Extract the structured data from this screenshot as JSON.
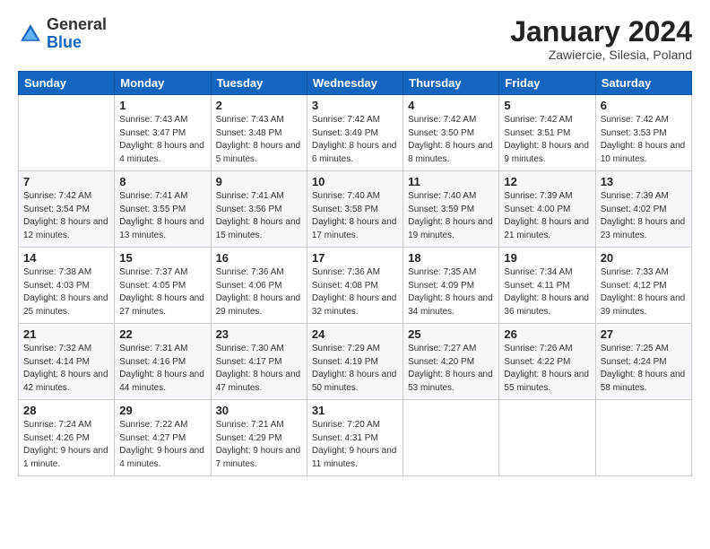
{
  "logo": {
    "general": "General",
    "blue": "Blue"
  },
  "title": "January 2024",
  "location": "Zawiercie, Silesia, Poland",
  "days_of_week": [
    "Sunday",
    "Monday",
    "Tuesday",
    "Wednesday",
    "Thursday",
    "Friday",
    "Saturday"
  ],
  "weeks": [
    [
      {
        "day": "",
        "sunrise": "",
        "sunset": "",
        "daylight": ""
      },
      {
        "day": "1",
        "sunrise": "Sunrise: 7:43 AM",
        "sunset": "Sunset: 3:47 PM",
        "daylight": "Daylight: 8 hours and 4 minutes."
      },
      {
        "day": "2",
        "sunrise": "Sunrise: 7:43 AM",
        "sunset": "Sunset: 3:48 PM",
        "daylight": "Daylight: 8 hours and 5 minutes."
      },
      {
        "day": "3",
        "sunrise": "Sunrise: 7:42 AM",
        "sunset": "Sunset: 3:49 PM",
        "daylight": "Daylight: 8 hours and 6 minutes."
      },
      {
        "day": "4",
        "sunrise": "Sunrise: 7:42 AM",
        "sunset": "Sunset: 3:50 PM",
        "daylight": "Daylight: 8 hours and 8 minutes."
      },
      {
        "day": "5",
        "sunrise": "Sunrise: 7:42 AM",
        "sunset": "Sunset: 3:51 PM",
        "daylight": "Daylight: 8 hours and 9 minutes."
      },
      {
        "day": "6",
        "sunrise": "Sunrise: 7:42 AM",
        "sunset": "Sunset: 3:53 PM",
        "daylight": "Daylight: 8 hours and 10 minutes."
      }
    ],
    [
      {
        "day": "7",
        "sunrise": "Sunrise: 7:42 AM",
        "sunset": "Sunset: 3:54 PM",
        "daylight": "Daylight: 8 hours and 12 minutes."
      },
      {
        "day": "8",
        "sunrise": "Sunrise: 7:41 AM",
        "sunset": "Sunset: 3:55 PM",
        "daylight": "Daylight: 8 hours and 13 minutes."
      },
      {
        "day": "9",
        "sunrise": "Sunrise: 7:41 AM",
        "sunset": "Sunset: 3:56 PM",
        "daylight": "Daylight: 8 hours and 15 minutes."
      },
      {
        "day": "10",
        "sunrise": "Sunrise: 7:40 AM",
        "sunset": "Sunset: 3:58 PM",
        "daylight": "Daylight: 8 hours and 17 minutes."
      },
      {
        "day": "11",
        "sunrise": "Sunrise: 7:40 AM",
        "sunset": "Sunset: 3:59 PM",
        "daylight": "Daylight: 8 hours and 19 minutes."
      },
      {
        "day": "12",
        "sunrise": "Sunrise: 7:39 AM",
        "sunset": "Sunset: 4:00 PM",
        "daylight": "Daylight: 8 hours and 21 minutes."
      },
      {
        "day": "13",
        "sunrise": "Sunrise: 7:39 AM",
        "sunset": "Sunset: 4:02 PM",
        "daylight": "Daylight: 8 hours and 23 minutes."
      }
    ],
    [
      {
        "day": "14",
        "sunrise": "Sunrise: 7:38 AM",
        "sunset": "Sunset: 4:03 PM",
        "daylight": "Daylight: 8 hours and 25 minutes."
      },
      {
        "day": "15",
        "sunrise": "Sunrise: 7:37 AM",
        "sunset": "Sunset: 4:05 PM",
        "daylight": "Daylight: 8 hours and 27 minutes."
      },
      {
        "day": "16",
        "sunrise": "Sunrise: 7:36 AM",
        "sunset": "Sunset: 4:06 PM",
        "daylight": "Daylight: 8 hours and 29 minutes."
      },
      {
        "day": "17",
        "sunrise": "Sunrise: 7:36 AM",
        "sunset": "Sunset: 4:08 PM",
        "daylight": "Daylight: 8 hours and 32 minutes."
      },
      {
        "day": "18",
        "sunrise": "Sunrise: 7:35 AM",
        "sunset": "Sunset: 4:09 PM",
        "daylight": "Daylight: 8 hours and 34 minutes."
      },
      {
        "day": "19",
        "sunrise": "Sunrise: 7:34 AM",
        "sunset": "Sunset: 4:11 PM",
        "daylight": "Daylight: 8 hours and 36 minutes."
      },
      {
        "day": "20",
        "sunrise": "Sunrise: 7:33 AM",
        "sunset": "Sunset: 4:12 PM",
        "daylight": "Daylight: 8 hours and 39 minutes."
      }
    ],
    [
      {
        "day": "21",
        "sunrise": "Sunrise: 7:32 AM",
        "sunset": "Sunset: 4:14 PM",
        "daylight": "Daylight: 8 hours and 42 minutes."
      },
      {
        "day": "22",
        "sunrise": "Sunrise: 7:31 AM",
        "sunset": "Sunset: 4:16 PM",
        "daylight": "Daylight: 8 hours and 44 minutes."
      },
      {
        "day": "23",
        "sunrise": "Sunrise: 7:30 AM",
        "sunset": "Sunset: 4:17 PM",
        "daylight": "Daylight: 8 hours and 47 minutes."
      },
      {
        "day": "24",
        "sunrise": "Sunrise: 7:29 AM",
        "sunset": "Sunset: 4:19 PM",
        "daylight": "Daylight: 8 hours and 50 minutes."
      },
      {
        "day": "25",
        "sunrise": "Sunrise: 7:27 AM",
        "sunset": "Sunset: 4:20 PM",
        "daylight": "Daylight: 8 hours and 53 minutes."
      },
      {
        "day": "26",
        "sunrise": "Sunrise: 7:26 AM",
        "sunset": "Sunset: 4:22 PM",
        "daylight": "Daylight: 8 hours and 55 minutes."
      },
      {
        "day": "27",
        "sunrise": "Sunrise: 7:25 AM",
        "sunset": "Sunset: 4:24 PM",
        "daylight": "Daylight: 8 hours and 58 minutes."
      }
    ],
    [
      {
        "day": "28",
        "sunrise": "Sunrise: 7:24 AM",
        "sunset": "Sunset: 4:26 PM",
        "daylight": "Daylight: 9 hours and 1 minute."
      },
      {
        "day": "29",
        "sunrise": "Sunrise: 7:22 AM",
        "sunset": "Sunset: 4:27 PM",
        "daylight": "Daylight: 9 hours and 4 minutes."
      },
      {
        "day": "30",
        "sunrise": "Sunrise: 7:21 AM",
        "sunset": "Sunset: 4:29 PM",
        "daylight": "Daylight: 9 hours and 7 minutes."
      },
      {
        "day": "31",
        "sunrise": "Sunrise: 7:20 AM",
        "sunset": "Sunset: 4:31 PM",
        "daylight": "Daylight: 9 hours and 11 minutes."
      },
      {
        "day": "",
        "sunrise": "",
        "sunset": "",
        "daylight": ""
      },
      {
        "day": "",
        "sunrise": "",
        "sunset": "",
        "daylight": ""
      },
      {
        "day": "",
        "sunrise": "",
        "sunset": "",
        "daylight": ""
      }
    ]
  ]
}
